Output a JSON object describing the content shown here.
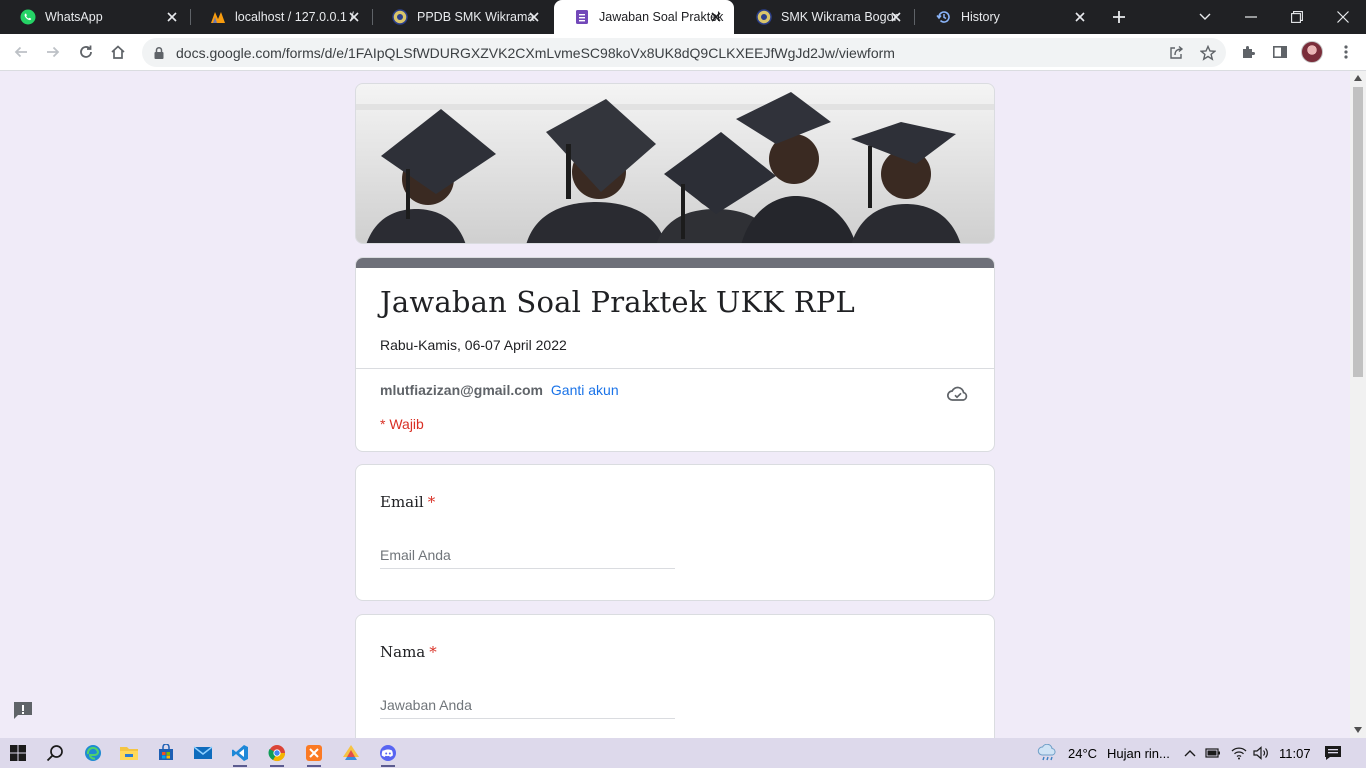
{
  "browser": {
    "tabs": [
      {
        "title": "WhatsApp",
        "icon": "whatsapp-icon"
      },
      {
        "title": "localhost / 127.0.0.1 /",
        "icon": "phpmyadmin-icon"
      },
      {
        "title": "PPDB SMK Wikrama",
        "icon": "school-logo-icon"
      },
      {
        "title": "Jawaban Soal Praktek",
        "icon": "google-forms-icon",
        "active": true
      },
      {
        "title": "SMK Wikrama Bogor",
        "icon": "school-logo-icon"
      },
      {
        "title": "History",
        "icon": "history-icon"
      }
    ],
    "url": "docs.google.com/forms/d/e/1FAIpQLSfWDURGXZVK2CXmLvmeSC98koVx8UK8dQ9CLKXEEJfWgJd2Jw/viewform"
  },
  "form": {
    "title": "Jawaban Soal Praktek UKK RPL",
    "description": "Rabu-Kamis, 06-07 April 2022",
    "account_email": "mlutfiazizan@gmail.com",
    "switch_account": "Ganti akun",
    "required_note": "* Wajib",
    "questions": [
      {
        "label": "Email",
        "required": "*",
        "placeholder": "Email Anda"
      },
      {
        "label": "Nama",
        "required": "*",
        "placeholder": "Jawaban Anda"
      }
    ]
  },
  "taskbar": {
    "weather_temp": "24°C",
    "weather_desc": "Hujan rin...",
    "clock": "11:07"
  },
  "colors": {
    "page_bg": "#f0ebf8",
    "header_bar": "#6e7079",
    "required": "#d93025",
    "link": "#1a73e8"
  }
}
